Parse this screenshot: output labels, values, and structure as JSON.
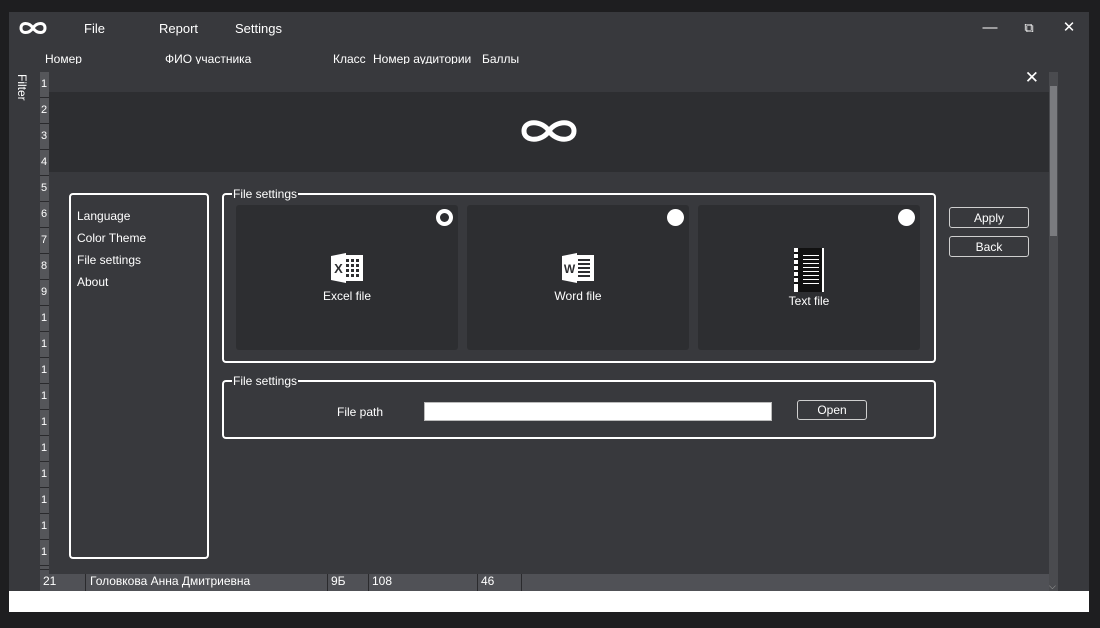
{
  "app": {
    "menu": [
      "File",
      "Report",
      "Settings"
    ],
    "window_controls": {
      "minimize": "—",
      "restore": "⧉",
      "close": "✕"
    },
    "filter_tab": "Filter"
  },
  "table": {
    "headers": [
      "Номер",
      "ФИО участника",
      "Класс",
      "Номер аудитории",
      "Баллы"
    ],
    "row_numbers": [
      "1",
      "2",
      "3",
      "4",
      "5",
      "6",
      "7",
      "8",
      "9",
      "1",
      "1",
      "1",
      "1",
      "1",
      "1",
      "1",
      "1",
      "1",
      "1",
      "2"
    ],
    "last_row": {
      "num": "21",
      "name": "Головкова Анна Дмитриевна",
      "class": "9Б",
      "room": "108",
      "score": "46"
    }
  },
  "dialog": {
    "close": "✕",
    "nav": [
      "Language",
      "Color Theme",
      "File settings",
      "About"
    ],
    "format_group_title": "File settings",
    "formats": [
      {
        "label": "Excel file",
        "icon": "excel-icon",
        "letter": "X",
        "selected": true
      },
      {
        "label": "Word file",
        "icon": "word-icon",
        "letter": "W",
        "selected": false
      },
      {
        "label": "Text file",
        "icon": "text-file-icon",
        "letter": "",
        "selected": false
      }
    ],
    "path_group_title": "File settings",
    "file_path_label": "File path",
    "file_path_value": "",
    "open_button": "Open",
    "apply_button": "Apply",
    "back_button": "Back"
  },
  "colors": {
    "background": "#38393d",
    "banner": "#2d2e31",
    "accent": "#ffffff"
  }
}
